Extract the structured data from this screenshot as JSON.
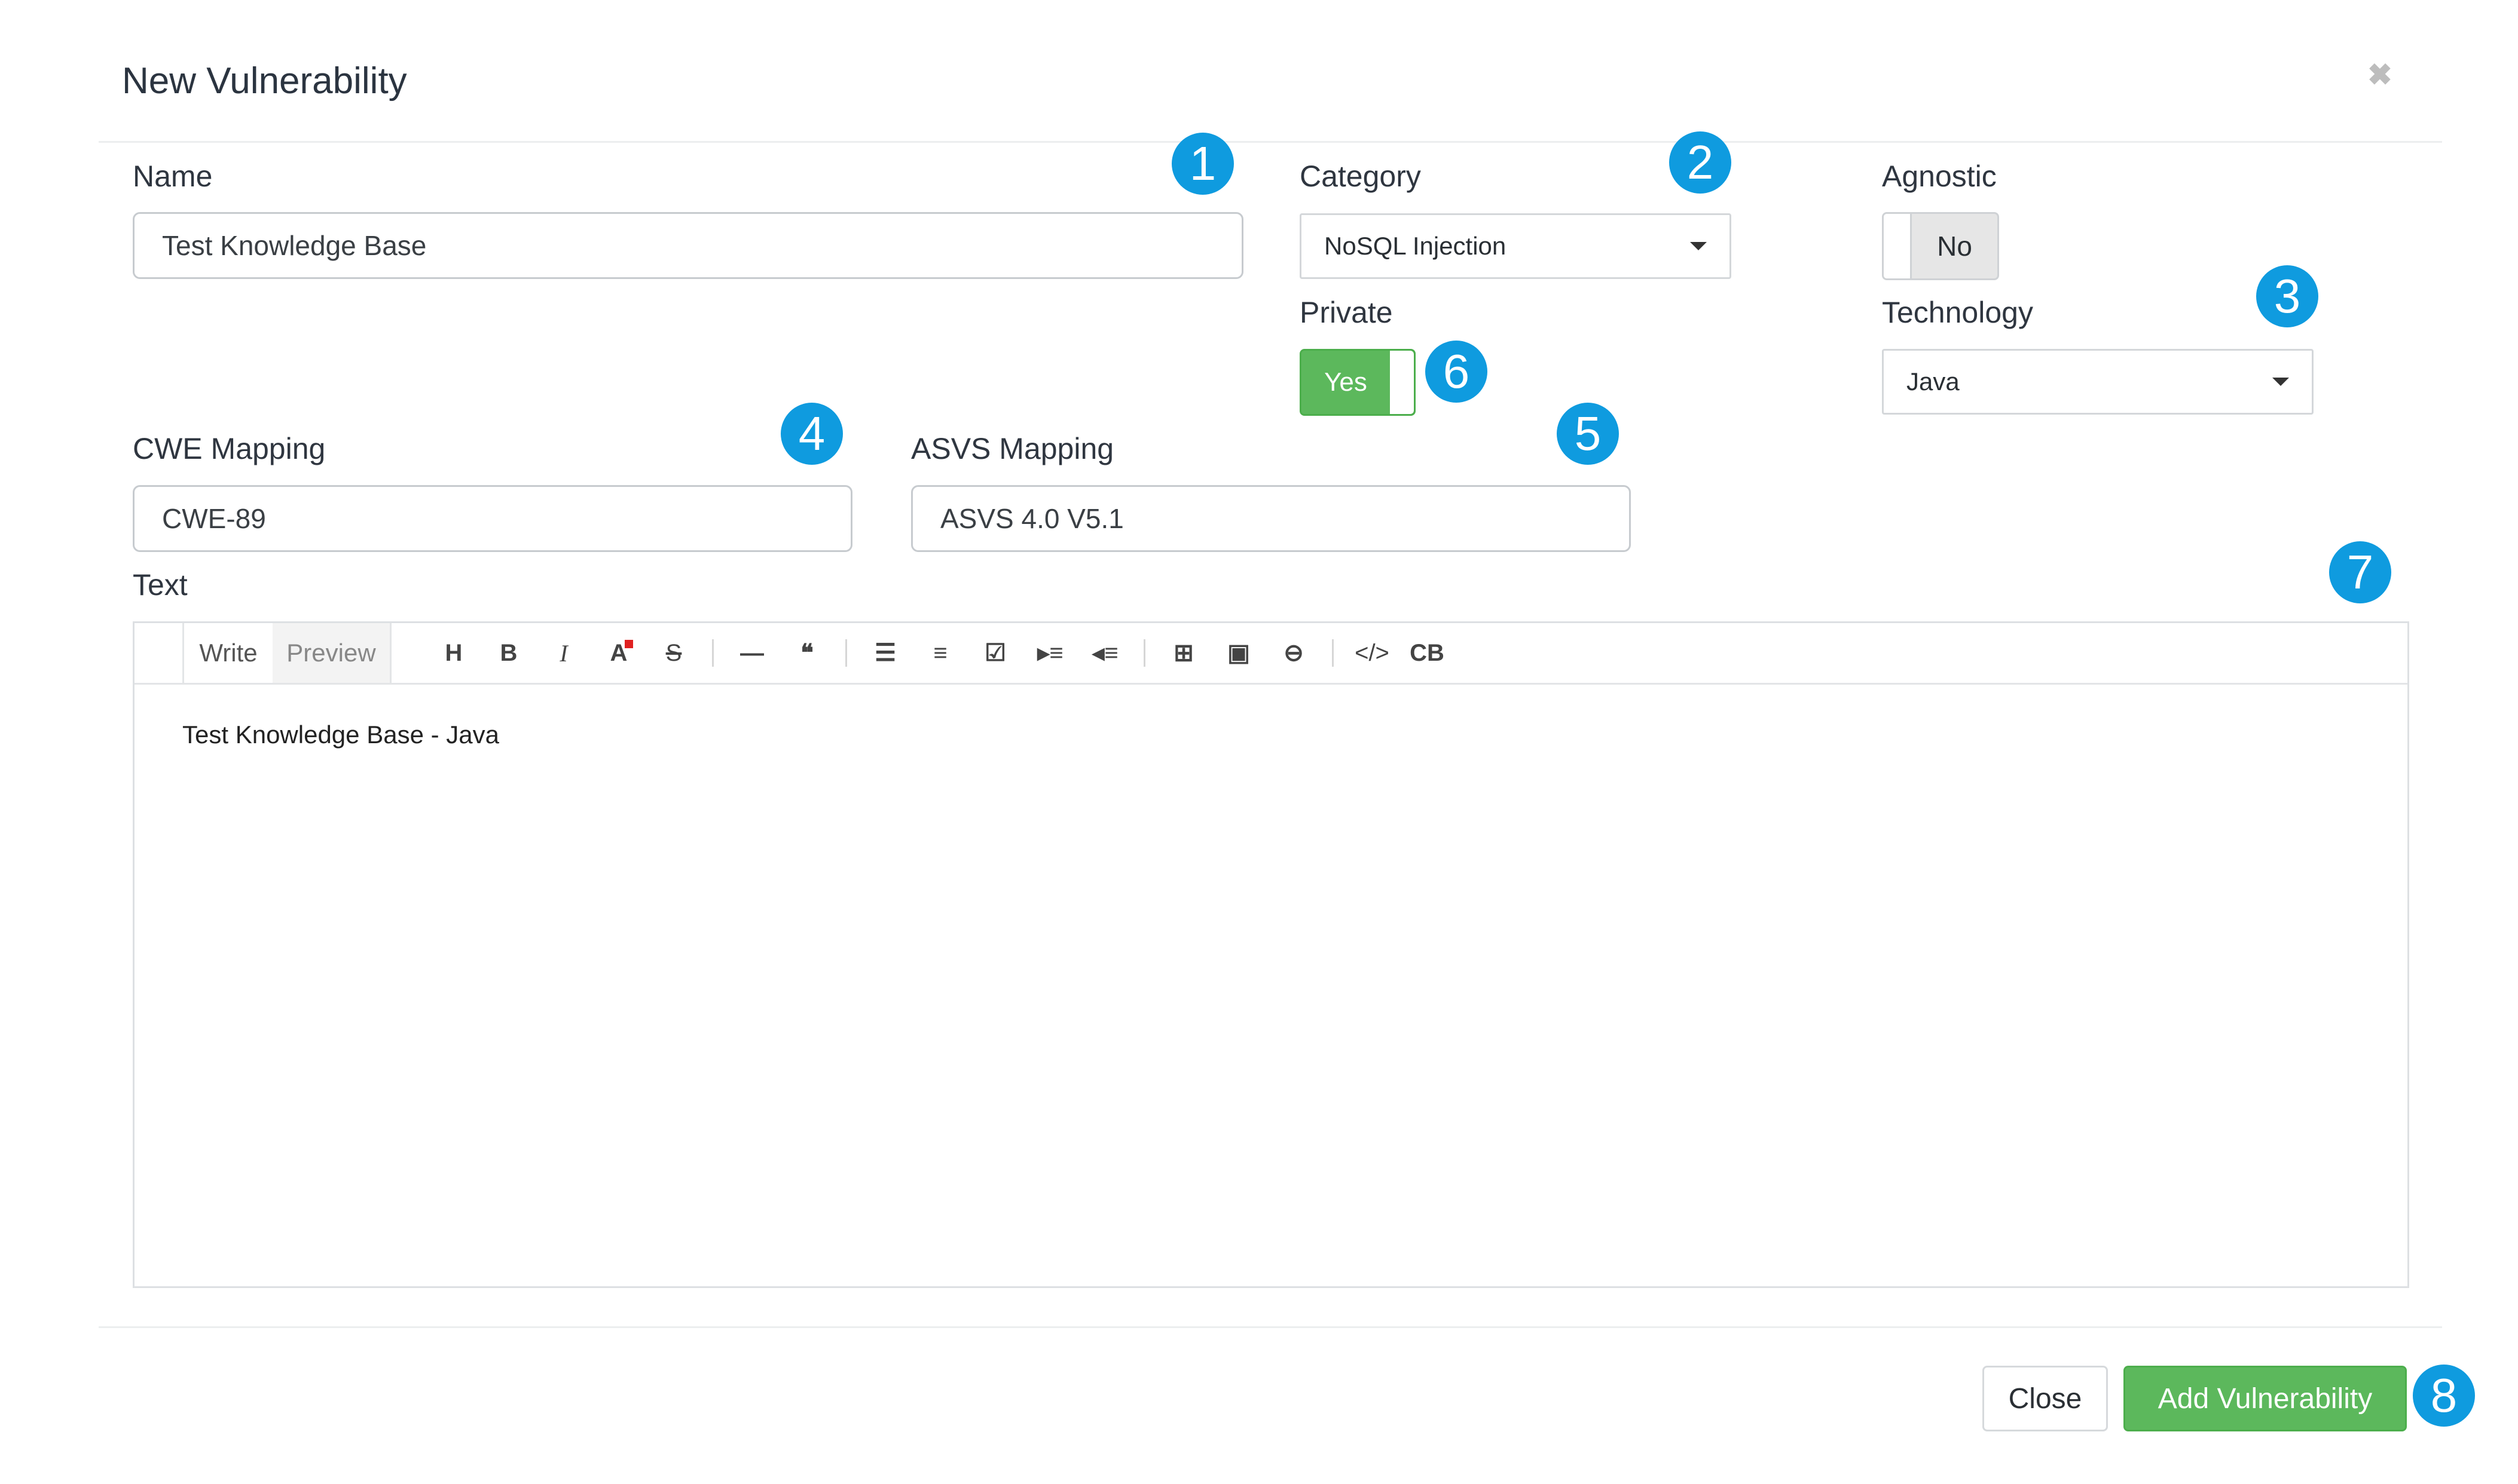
{
  "dialog": {
    "title": "New Vulnerability"
  },
  "name_field": {
    "label": "Name",
    "value": "Test Knowledge Base"
  },
  "category_field": {
    "label": "Category",
    "value": "NoSQL Injection"
  },
  "agnostic_field": {
    "label": "Agnostic",
    "toggle_text": "No"
  },
  "private_field": {
    "label": "Private",
    "toggle_text": "Yes"
  },
  "technology_field": {
    "label": "Technology",
    "value": "Java"
  },
  "cwe_field": {
    "label": "CWE Mapping",
    "value": "CWE-89"
  },
  "asvs_field": {
    "label": "ASVS Mapping",
    "value": "ASVS 4.0 V5.1"
  },
  "text_field": {
    "label": "Text",
    "tabs": [
      "Write",
      "Preview"
    ],
    "toolbar_groups": [
      [
        "heading-icon",
        "bold-icon",
        "italic-icon",
        "text-color-icon",
        "strikethrough-icon"
      ],
      [
        "horizontal-rule-icon",
        "quote-icon"
      ],
      [
        "bullet-list-icon",
        "numbered-list-icon",
        "task-list-icon",
        "indent-icon",
        "outdent-icon"
      ],
      [
        "table-icon",
        "image-icon",
        "link-icon"
      ],
      [
        "code-icon",
        "code-block-icon"
      ]
    ],
    "toolbar_glyphs": {
      "heading": "H",
      "bold": "B",
      "italic": "I",
      "text_color": "A",
      "strikethrough": "S",
      "code": "</>",
      "code_block": "CB"
    },
    "content": "Test Knowledge Base - Java"
  },
  "footer": {
    "close_label": "Close",
    "add_label": "Add Vulnerability"
  },
  "badges": [
    "1",
    "2",
    "3",
    "4",
    "5",
    "6",
    "7",
    "8"
  ],
  "colors": {
    "badge": "#0f9bdf",
    "primary_green": "#5cb85c"
  }
}
